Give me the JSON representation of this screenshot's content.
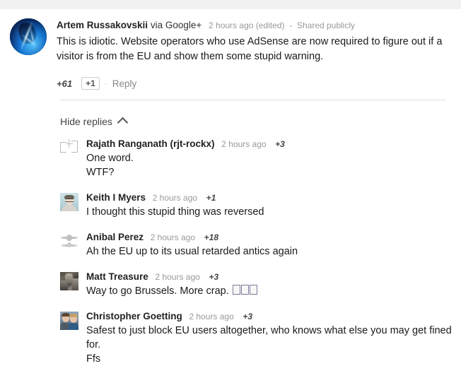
{
  "root_comment": {
    "author": "Artem Russakovskii",
    "via": "via Google+",
    "timestamp": "2 hours ago (edited)",
    "separator": "-",
    "visibility": "Shared publicly",
    "text": "This is idiotic. Website operators who use AdSense are now required to figure out if a visitor is from the EU and show them some stupid warning.",
    "plus_count": "+61",
    "plus_one_label": "+1",
    "action_sep": "·",
    "reply_label": "Reply",
    "avatar_name": "artem-avatar"
  },
  "toggle": {
    "label": "Hide replies",
    "icon": "chevron-up-icon"
  },
  "replies": [
    {
      "author": "Rajath Ranganath (rjt-rockx)",
      "timestamp": "2 hours ago",
      "plus_count": "+3",
      "text": "One word.\nWTF?",
      "avatar_type": "broken-image",
      "avatar_name": "broken-image-icon"
    },
    {
      "author": "Keith I Myers",
      "timestamp": "2 hours ago",
      "plus_count": "+1",
      "text": "I thought this stupid thing was reversed",
      "avatar_type": "face",
      "avatar_name": "keith-avatar"
    },
    {
      "author": "Anibal Perez",
      "timestamp": "2 hours ago",
      "plus_count": "+18",
      "text": "Ah the EU up to its usual retarded antics again",
      "avatar_type": "emblem",
      "avatar_name": "anibal-avatar"
    },
    {
      "author": "Matt Treasure",
      "timestamp": "2 hours ago",
      "plus_count": "+3",
      "text": "Way to go Brussels. More crap. ",
      "trailing_tofu": 3,
      "avatar_type": "photo",
      "avatar_name": "matt-avatar"
    },
    {
      "author": "Christopher Goetting",
      "timestamp": "2 hours ago",
      "plus_count": "+3",
      "text": "Safest to just block EU users altogether, who knows what else you may get fined for.\nFfs",
      "avatar_type": "couple",
      "avatar_name": "christopher-avatar"
    }
  ],
  "colors": {
    "top_band": "#f1f1f1",
    "text": "#1a1a1a",
    "meta": "#999999",
    "divider": "#e0e0e0",
    "border": "#cccccc"
  }
}
